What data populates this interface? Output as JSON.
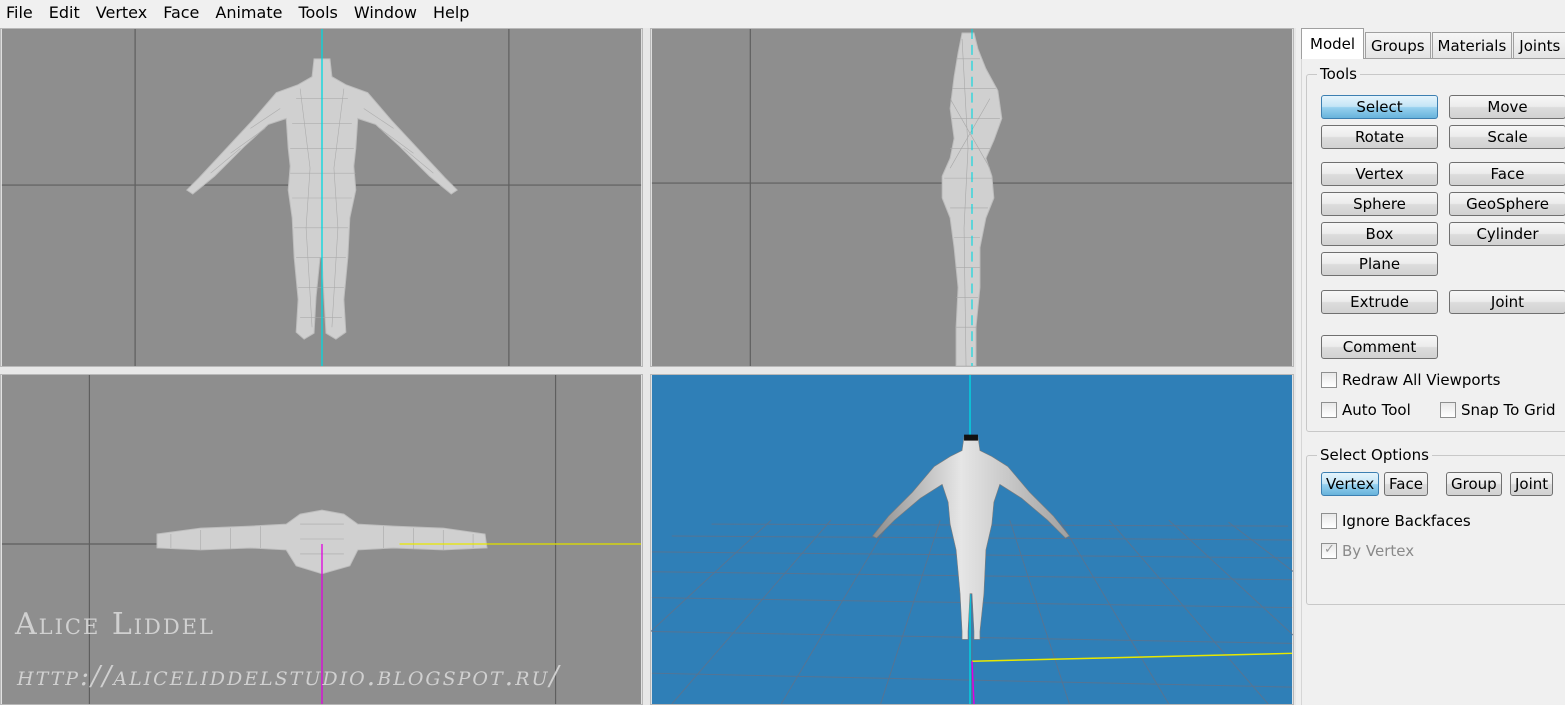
{
  "menu": [
    "File",
    "Edit",
    "Vertex",
    "Face",
    "Animate",
    "Tools",
    "Window",
    "Help"
  ],
  "watermark": {
    "name": "Alice Liddel",
    "url": "http://aliceliddelstudio.blogspot.ru/"
  },
  "viewports": {
    "colors": {
      "ortho_bg": "#8e8e8e",
      "grid": "#5f5f5f",
      "persp_bg": "#2f7fb7",
      "mesh": "#d3d3d3",
      "axis_y": "#00d8e0",
      "axis_x": "#e8e800",
      "axis_z": "#e000e0"
    }
  },
  "panel": {
    "tabs": [
      "Model",
      "Groups",
      "Materials",
      "Joints"
    ],
    "tools_label": "Tools",
    "tool_buttons": [
      "Select",
      "Move",
      "Rotate",
      "Scale",
      "Vertex",
      "Face",
      "Sphere",
      "GeoSphere",
      "Box",
      "Cylinder",
      "Plane",
      "Extrude",
      "Joint",
      "Comment"
    ],
    "redraw_all": "Redraw All Viewports",
    "auto_tool": "Auto Tool",
    "snap_to_grid": "Snap To Grid",
    "select_options_label": "Select Options",
    "select_buttons": [
      "Vertex",
      "Face",
      "Group",
      "Joint"
    ],
    "ignore_backfaces": "Ignore Backfaces",
    "by_vertex": "By Vertex",
    "accent": "#68b3db"
  }
}
